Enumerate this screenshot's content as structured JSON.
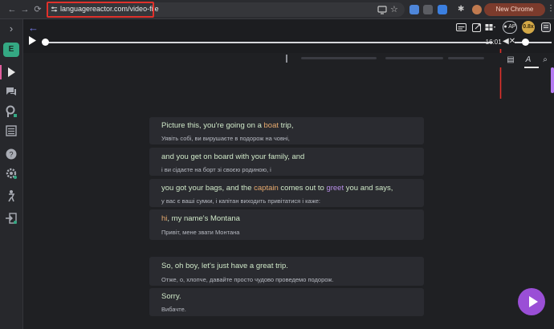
{
  "browser": {
    "url": "languagereactor.com/video-file",
    "update_label": "New Chrome available",
    "nav_back": "←",
    "nav_forward": "→",
    "nav_reload": "C"
  },
  "sidebar": {
    "badge_letter": "E",
    "items": [
      "chevron-right-icon",
      "play-icon",
      "chat-icon",
      "phrasepump-icon",
      "list-icon",
      "help-icon",
      "settings-icon",
      "person-icon",
      "logout-icon"
    ]
  },
  "player": {
    "time_remaining": "-16:01",
    "ap_label": "AP",
    "speed_label": "0.8x",
    "progress_fraction": 0.0
  },
  "subtitles": [
    {
      "en_parts": [
        {
          "t": "Picture this, you're going on a ",
          "c": ""
        },
        {
          "t": "boat",
          "c": "orange"
        },
        {
          "t": " trip,",
          "c": ""
        }
      ],
      "uk": "Уявіть собі, ви вирушаєте в подорож на човні,"
    },
    {
      "en_parts": [
        {
          "t": "and you get on board with your family, and",
          "c": ""
        }
      ],
      "uk": "і ви сідаєте на борт зі своєю родиною, і"
    },
    {
      "en_parts": [
        {
          "t": "you got your bags, and the ",
          "c": ""
        },
        {
          "t": "captain",
          "c": "orange"
        },
        {
          "t": " comes out to ",
          "c": ""
        },
        {
          "t": "greet",
          "c": "purple"
        },
        {
          "t": " you and says,",
          "c": ""
        }
      ],
      "uk": "у вас є ваші сумки, і капітан виходить привітатися і каже:"
    },
    {
      "en_parts": [
        {
          "t": "hi",
          "c": "orange"
        },
        {
          "t": ", my name's Montana",
          "c": ""
        }
      ],
      "uk": "Привіт, мене звати Монтана"
    },
    {
      "en_parts": [
        {
          "t": "So, oh boy, let's just have a great trip.",
          "c": ""
        }
      ],
      "uk": "Отже, о, хлопче, давайте просто чудово проведемо подорож."
    },
    {
      "en_parts": [
        {
          "t": "Sorry.",
          "c": ""
        }
      ],
      "uk": "Вибачте."
    }
  ]
}
